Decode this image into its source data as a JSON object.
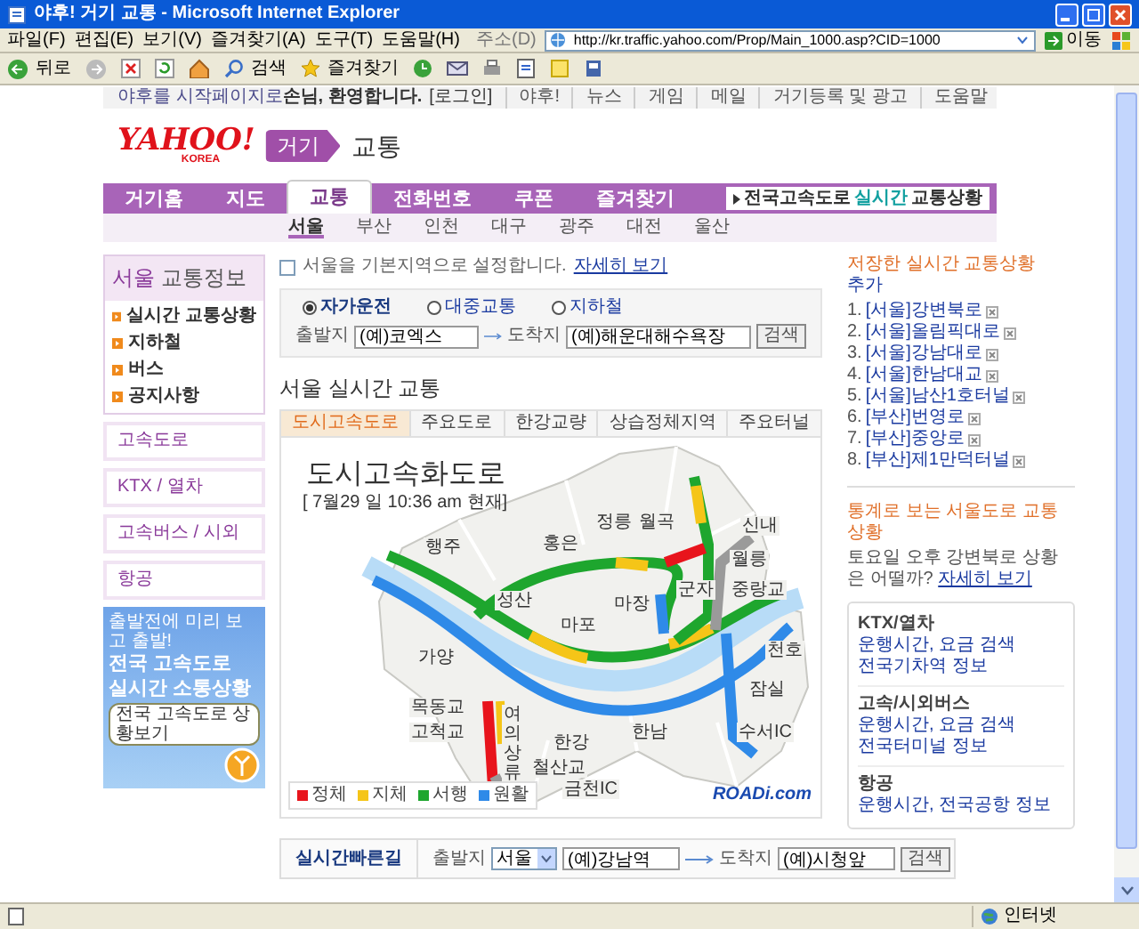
{
  "window": {
    "title": "야후! 거기 교통 - Microsoft Internet Explorer"
  },
  "menu": [
    "파일(F)",
    "편집(E)",
    "보기(V)",
    "즐겨찾기(A)",
    "도구(T)",
    "도움말(H)"
  ],
  "address": {
    "label": "주소(D)",
    "url": "http://kr.traffic.yahoo.com/Prop/Main_1000.asp?CID=1000",
    "go": "이동"
  },
  "toolbar": {
    "back": "뒤로",
    "search": "검색",
    "favorites": "즐겨찾기"
  },
  "top_strip": {
    "start_link": "야후를 시작페이지로",
    "greeting": "손님, 환영합니다.",
    "login": "[로그인]",
    "links": [
      "야후!",
      "뉴스",
      "게임",
      "메일",
      "거기등록 및 광고",
      "도움말"
    ]
  },
  "logo": {
    "brand": "YAHOO!",
    "sub": "KOREA",
    "service": "거기",
    "section": "교통"
  },
  "nav": {
    "tabs": [
      {
        "label": "거기홈",
        "selected": false
      },
      {
        "label": "지도",
        "selected": false
      },
      {
        "label": "교통",
        "selected": true
      },
      {
        "label": "전화번호",
        "selected": false
      },
      {
        "label": "쿠폰",
        "selected": false
      },
      {
        "label": "즐겨찾기",
        "selected": false
      }
    ],
    "highway_button": [
      "전국고속도로 ",
      "실시간",
      " 교통상황"
    ]
  },
  "cities": [
    {
      "label": "서울",
      "selected": true
    },
    {
      "label": "부산",
      "selected": false
    },
    {
      "label": "인천",
      "selected": false
    },
    {
      "label": "대구",
      "selected": false
    },
    {
      "label": "광주",
      "selected": false
    },
    {
      "label": "대전",
      "selected": false
    },
    {
      "label": "울산",
      "selected": false
    }
  ],
  "sidebar": {
    "title_city": "서울",
    "title_rest": "교통정보",
    "items": [
      "실시간 교통상황",
      "지하철",
      "버스",
      "공지사항"
    ],
    "boxes": [
      "고속도로",
      "KTX / 열차",
      "고속버스 / 시외",
      "항공"
    ],
    "banner": {
      "lines": [
        "출발전에 미리 보고 출발!",
        "전국 고속도로",
        "실시간 소통상황"
      ],
      "button": "전국 고속도로 상황보기"
    }
  },
  "default_region": {
    "checked": false,
    "text": "서울을 기본지역으로 설정합니다.",
    "link": "자세히 보기"
  },
  "route_search": {
    "modes": [
      {
        "label": "자가운전",
        "selected": true
      },
      {
        "label": "대중교통",
        "selected": false
      },
      {
        "label": "지하철",
        "selected": false
      }
    ],
    "from_label": "출발지",
    "from_value": "(예)코엑스",
    "to_label": "도착지",
    "to_value": "(예)해운대해수욕장",
    "button": "검색"
  },
  "realtime": {
    "heading": "서울 실시간 교통",
    "tabs": [
      {
        "label": "도시고속도로",
        "selected": true
      },
      {
        "label": "주요도로",
        "selected": false
      },
      {
        "label": "한강교량",
        "selected": false
      },
      {
        "label": "상습정체지역",
        "selected": false
      },
      {
        "label": "주요터널",
        "selected": false
      }
    ],
    "map_title": "도시고속화도로",
    "map_time": "[ 7월29 일  10:36 am 현재]",
    "places": [
      "행주",
      "성산",
      "홍은",
      "정릉",
      "월곡",
      "신내",
      "월릉",
      "중랑교",
      "마장",
      "군자",
      "마포",
      "가양",
      "천호",
      "잠실",
      "한남",
      "수서IC",
      "한강",
      "여의 상류",
      "목동교",
      "고척교",
      "철산교",
      "금천IC"
    ],
    "legend": [
      {
        "label": "정체",
        "color": "#e8141c"
      },
      {
        "label": "지체",
        "color": "#f5c518"
      },
      {
        "label": "서행",
        "color": "#1ea62e"
      },
      {
        "label": "원활",
        "color": "#2f8ae8"
      }
    ],
    "map_logo": "ROADi.com"
  },
  "quick_route": {
    "title": "실시간빠른길",
    "from_label": "출발지",
    "city": "서울",
    "from_value": "(예)강남역",
    "to_label": "도착지",
    "to_value": "(예)시청앞",
    "button": "검색"
  },
  "saved": {
    "heading": "저장한 실시간 교통상황",
    "add": "추가",
    "items": [
      {
        "number": "1.",
        "name": "[서울]강변북로"
      },
      {
        "number": "2.",
        "name": "[서울]올림픽대로"
      },
      {
        "number": "3.",
        "name": "[서울]강남대로"
      },
      {
        "number": "4.",
        "name": "[서울]한남대교"
      },
      {
        "number": "5.",
        "name": "[서울]남산1호터널"
      },
      {
        "number": "6.",
        "name": "[부산]번영로"
      },
      {
        "number": "7.",
        "name": "[부산]중앙로"
      },
      {
        "number": "8.",
        "name": "[부산]제1만덕터널"
      }
    ]
  },
  "stats": {
    "heading": "통계로 보는 서울도로 교통상황",
    "text": "토요일 오후 강변북로 상황은 어떨까?",
    "link": "자세히 보기"
  },
  "transport": [
    {
      "title": "KTX/열차",
      "links": [
        "운행시간, 요금 검색",
        "전국기차역 정보"
      ]
    },
    {
      "title": "고속/시외버스",
      "links": [
        "운행시간, 요금 검색",
        "전국터미널 정보"
      ]
    },
    {
      "title": "항공",
      "links": [
        "운행시간, 전국공항 정보"
      ]
    }
  ],
  "status_bar": {
    "zone": "인터넷"
  }
}
